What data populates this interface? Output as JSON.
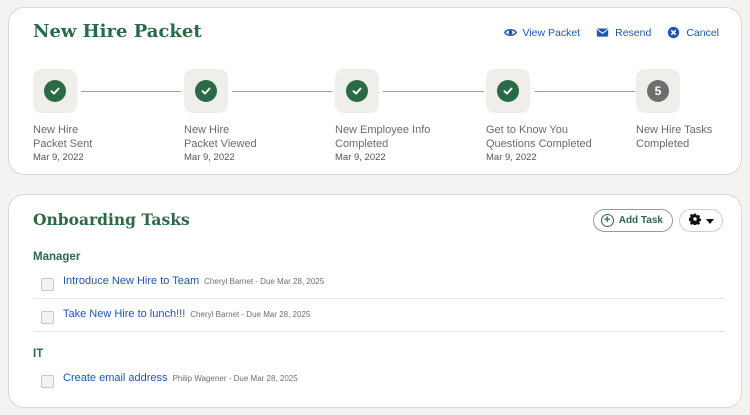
{
  "packet": {
    "title": "New Hire Packet",
    "actions": [
      {
        "label": "View Packet",
        "icon": "eye-icon"
      },
      {
        "label": "Resend",
        "icon": "envelope-icon"
      },
      {
        "label": "Cancel",
        "icon": "close-circle-icon"
      }
    ],
    "steps": [
      {
        "label": "New Hire\nPacket Sent",
        "date": "Mar 9, 2022",
        "status": "completed"
      },
      {
        "label": "New Hire\nPacket Viewed",
        "date": "Mar 9, 2022",
        "status": "completed"
      },
      {
        "label": "New Employee Info\nCompleted",
        "date": "Mar 9, 2022",
        "status": "completed"
      },
      {
        "label": "Get to Know You\nQuestions Completed",
        "date": "Mar 9, 2022",
        "status": "completed"
      },
      {
        "label": "New Hire Tasks\nCompleted",
        "date": "",
        "status": "pending",
        "number": "5"
      }
    ]
  },
  "tasks": {
    "title": "Onboarding Tasks",
    "add_label": "Add Task",
    "groups": [
      {
        "name": "Manager",
        "items": [
          {
            "title": "Introduce New Hire to Team",
            "meta": "Cheryl Barnet - Due Mar 28, 2025"
          },
          {
            "title": "Take New Hire to lunch!!!",
            "meta": "Cheryl Barnet - Due Mar 28, 2025"
          }
        ]
      },
      {
        "name": "IT",
        "items": [
          {
            "title": "Create email address",
            "meta": "Philip Wagener - Due Mar 28, 2025"
          }
        ]
      }
    ]
  },
  "colors": {
    "accent_green": "#2b6a46",
    "link_blue": "#1e56b3"
  }
}
